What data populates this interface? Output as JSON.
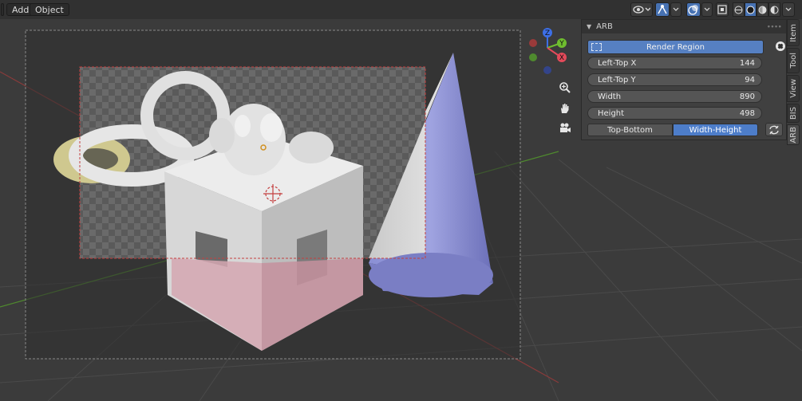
{
  "header": {
    "menu": [
      "Add",
      "Object"
    ]
  },
  "icons": {
    "visibility": "eye-icon",
    "gizmo": "gizmo-icon",
    "overlay": "overlay-icon",
    "xray": "xray-icon",
    "shading": [
      "wireframe",
      "solid",
      "material",
      "rendered"
    ],
    "nav": [
      "zoom-icon",
      "hand-icon",
      "camera-icon"
    ]
  },
  "gizmo_axes": {
    "z": "Z",
    "y": "Y",
    "x": "X"
  },
  "colors": {
    "accent": "#4772b3",
    "button_active": "#5680c2",
    "axis_x": "#e44a5a",
    "axis_y": "#6fbd2f",
    "axis_z": "#3d6fe6",
    "render_region_border": "#c44040"
  },
  "panel": {
    "title": "ARB",
    "render_button": "Render Region",
    "fields": [
      {
        "label": "Left-Top X",
        "value": "144"
      },
      {
        "label": "Left-Top Y",
        "value": "94"
      },
      {
        "label": "Width",
        "value": "890"
      },
      {
        "label": "Height",
        "value": "498"
      }
    ],
    "mode_options": [
      "Top-Bottom",
      "Width-Height"
    ],
    "mode_selected": "Width-Height"
  },
  "tabs": [
    "Item",
    "Tool",
    "View",
    "BIS",
    "ARB"
  ],
  "active_tab": "ARB"
}
